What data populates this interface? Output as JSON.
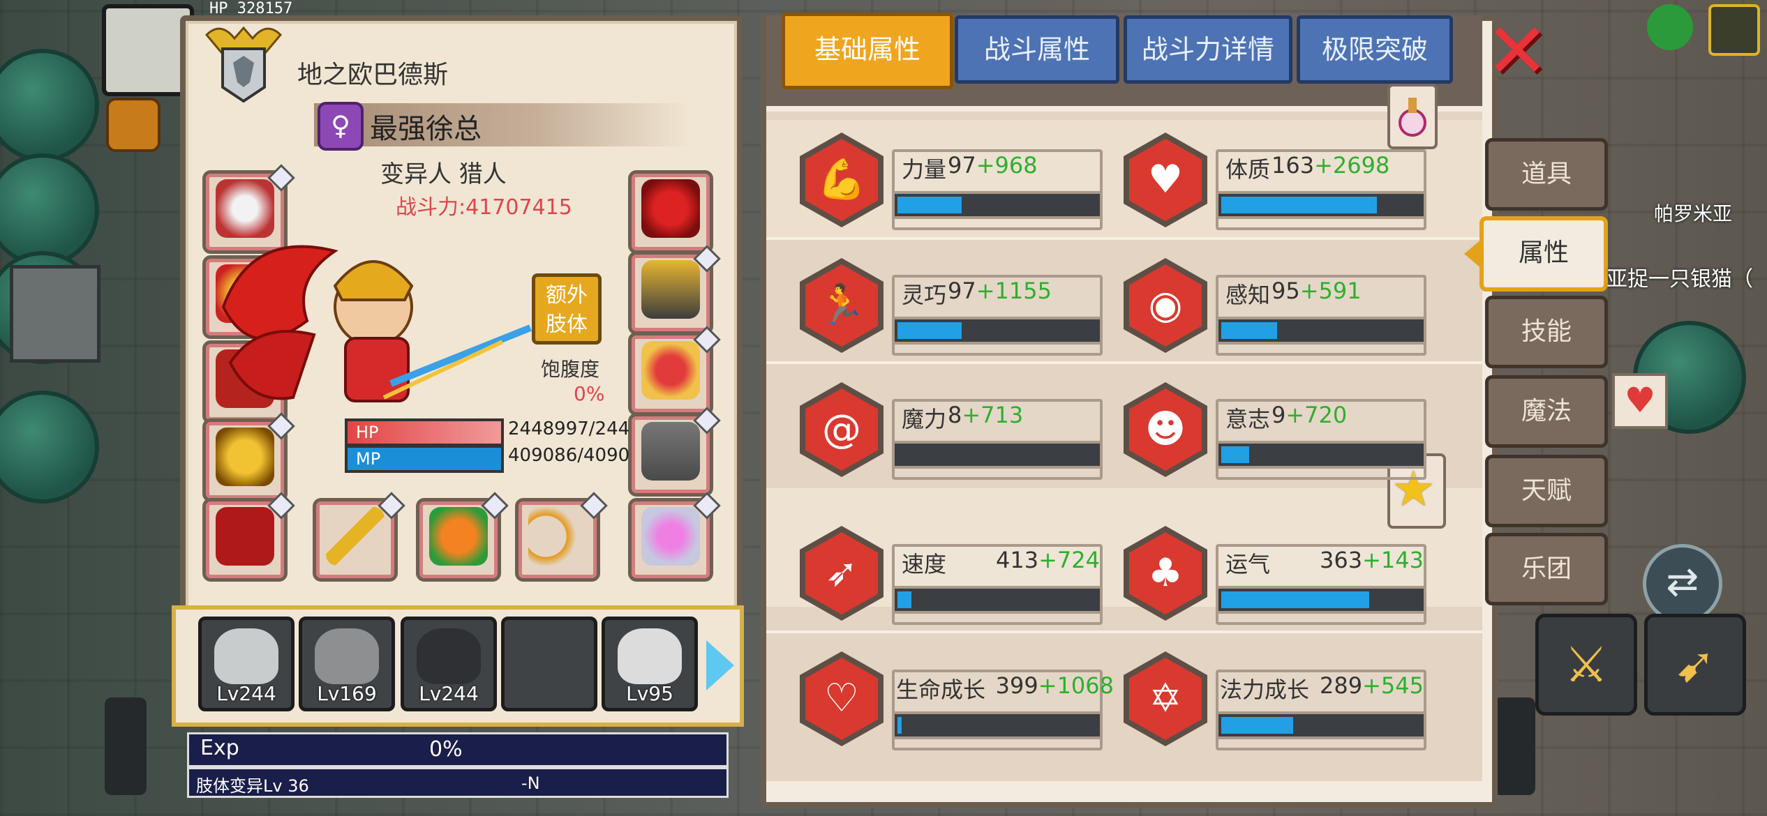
{
  "top_hud": {
    "hp_label": "HP",
    "hp_value": "328157"
  },
  "character": {
    "guild_name": "地之欧巴德斯",
    "gender_symbol": "♀",
    "name": "最强徐总",
    "class": "变异人 猎人",
    "power": "战斗力:41707415",
    "extra_limb_btn": "额外\n肢体",
    "hunger_label": "饱腹度",
    "hunger_value": "0%",
    "hp_label": "HP",
    "hp_value": "2448997/244",
    "mp_label": "MP",
    "mp_value": "409086/4090"
  },
  "party": [
    {
      "level": "Lv244"
    },
    {
      "level": "Lv169"
    },
    {
      "level": "Lv244"
    },
    {
      "level": ""
    },
    {
      "level": "Lv95"
    }
  ],
  "exp": {
    "label": "Exp",
    "value": "0%"
  },
  "mutation": {
    "label": "肢体变异Lv 36",
    "value": "-N"
  },
  "tabs": [
    {
      "label": "基础属性",
      "active": true
    },
    {
      "label": "战斗属性",
      "active": false
    },
    {
      "label": "战斗力详情",
      "active": false
    },
    {
      "label": "极限突破",
      "active": false
    }
  ],
  "stats": [
    {
      "name": "力量",
      "base": "97",
      "bonus": "+968",
      "fill": 0.32,
      "icon": "muscle-icon"
    },
    {
      "name": "体质",
      "base": "163",
      "bonus": "+2698",
      "fill": 0.78,
      "icon": "body-icon"
    },
    {
      "name": "灵巧",
      "base": "97",
      "bonus": "+1155",
      "fill": 0.32,
      "icon": "runner-icon"
    },
    {
      "name": "感知",
      "base": "95",
      "bonus": "+591",
      "fill": 0.28,
      "icon": "eye-icon"
    },
    {
      "name": "魔力",
      "base": "8",
      "bonus": "+713",
      "fill": 0.0,
      "icon": "swirl-icon"
    },
    {
      "name": "意志",
      "base": "9",
      "bonus": "+720",
      "fill": 0.14,
      "icon": "head-icon"
    },
    {
      "name": "速度",
      "base": "413",
      "bonus": "+724",
      "fill": 0.07,
      "icon": "wing-icon"
    },
    {
      "name": "运气",
      "base": "363",
      "bonus": "+143",
      "fill": 0.74,
      "icon": "clover-icon"
    },
    {
      "name": "生命成长",
      "base": "399",
      "bonus": "+1068",
      "fill": 0.02,
      "icon": "heart-growth-icon"
    },
    {
      "name": "法力成长",
      "base": "289",
      "bonus": "+545",
      "fill": 0.36,
      "icon": "mana-growth-icon"
    }
  ],
  "side_menu": [
    {
      "label": "道具",
      "active": false
    },
    {
      "label": "属性",
      "active": true
    },
    {
      "label": "技能",
      "active": false
    },
    {
      "label": "魔法",
      "active": false
    },
    {
      "label": "天赋",
      "active": false
    },
    {
      "label": "乐团",
      "active": false
    }
  ],
  "world": {
    "location": "帕罗米亚",
    "quest": "亚捉一只银猫（"
  },
  "colors": {
    "accent_tab": "#f0a51f",
    "tab": "#4e73b4",
    "stat_fill": "#22a0e6",
    "bonus": "#2fae2f",
    "power": "#e0444b"
  }
}
